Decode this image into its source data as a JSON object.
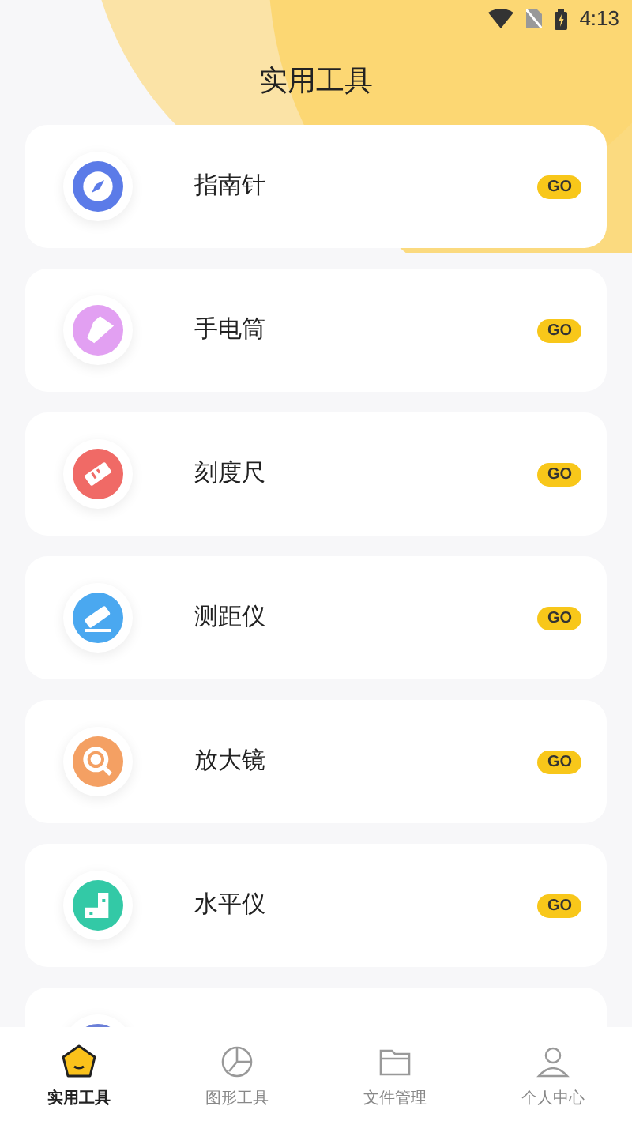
{
  "status_bar": {
    "time": "4:13"
  },
  "title": "实用工具",
  "tools": [
    {
      "kind": "compass",
      "label": "指南针",
      "color": "#5b7be8",
      "action": "GO"
    },
    {
      "kind": "flashlight",
      "label": "手电筒",
      "color": "#e2a0f2",
      "action": "GO"
    },
    {
      "kind": "ruler",
      "label": "刻度尺",
      "color": "#f06a66",
      "action": "GO"
    },
    {
      "kind": "rangefinder",
      "label": "测距仪",
      "color": "#4aa8f0",
      "action": "GO"
    },
    {
      "kind": "magnifier",
      "label": "放大镜",
      "color": "#f4a063",
      "action": "GO"
    },
    {
      "kind": "level",
      "label": "水平仪",
      "color": "#33c9a6",
      "action": "GO"
    },
    {
      "kind": "partial",
      "color": "#6b7fd8"
    }
  ],
  "tabs": [
    {
      "kind": "tools",
      "label": "实用工具",
      "selected": true
    },
    {
      "kind": "chart",
      "label": "图形工具",
      "selected": false
    },
    {
      "kind": "folder",
      "label": "文件管理",
      "selected": false
    },
    {
      "kind": "person",
      "label": "个人中心",
      "selected": false
    }
  ]
}
